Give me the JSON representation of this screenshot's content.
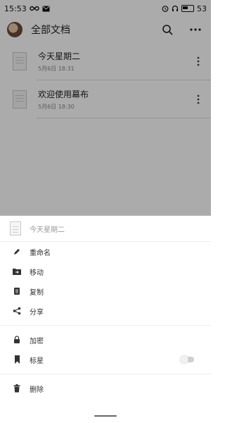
{
  "status_bar": {
    "time": "15:53",
    "left_icons": [
      "infinity-icon",
      "mail-icon"
    ],
    "right_icons": [
      "alarm-icon",
      "headphones-icon",
      "battery-icon"
    ],
    "battery_percent": "53"
  },
  "app_bar": {
    "title": "全部文档",
    "icons": [
      "search-icon",
      "more-icon"
    ]
  },
  "documents": [
    {
      "title": "今天星期二",
      "date": "5月6日 18:31"
    },
    {
      "title": "欢迎使用幕布",
      "date": "5月6日 18:30"
    }
  ],
  "sheet": {
    "doc_title": "今天星期二",
    "items": [
      {
        "label": "重命名",
        "icon": "pencil-icon"
      },
      {
        "label": "移动",
        "icon": "folder-move-icon"
      },
      {
        "label": "复制",
        "icon": "copy-icon"
      },
      {
        "label": "分享",
        "icon": "share-icon"
      },
      {
        "label": "加密",
        "icon": "lock-icon"
      },
      {
        "label": "标星",
        "icon": "bookmark-icon",
        "toggle_on": false
      },
      {
        "label": "删除",
        "icon": "trash-icon"
      }
    ]
  },
  "colors": {
    "overlay": "rgba(0,0,0,0.33)",
    "icon": "#333333",
    "muted_text": "#9a9a9a"
  }
}
